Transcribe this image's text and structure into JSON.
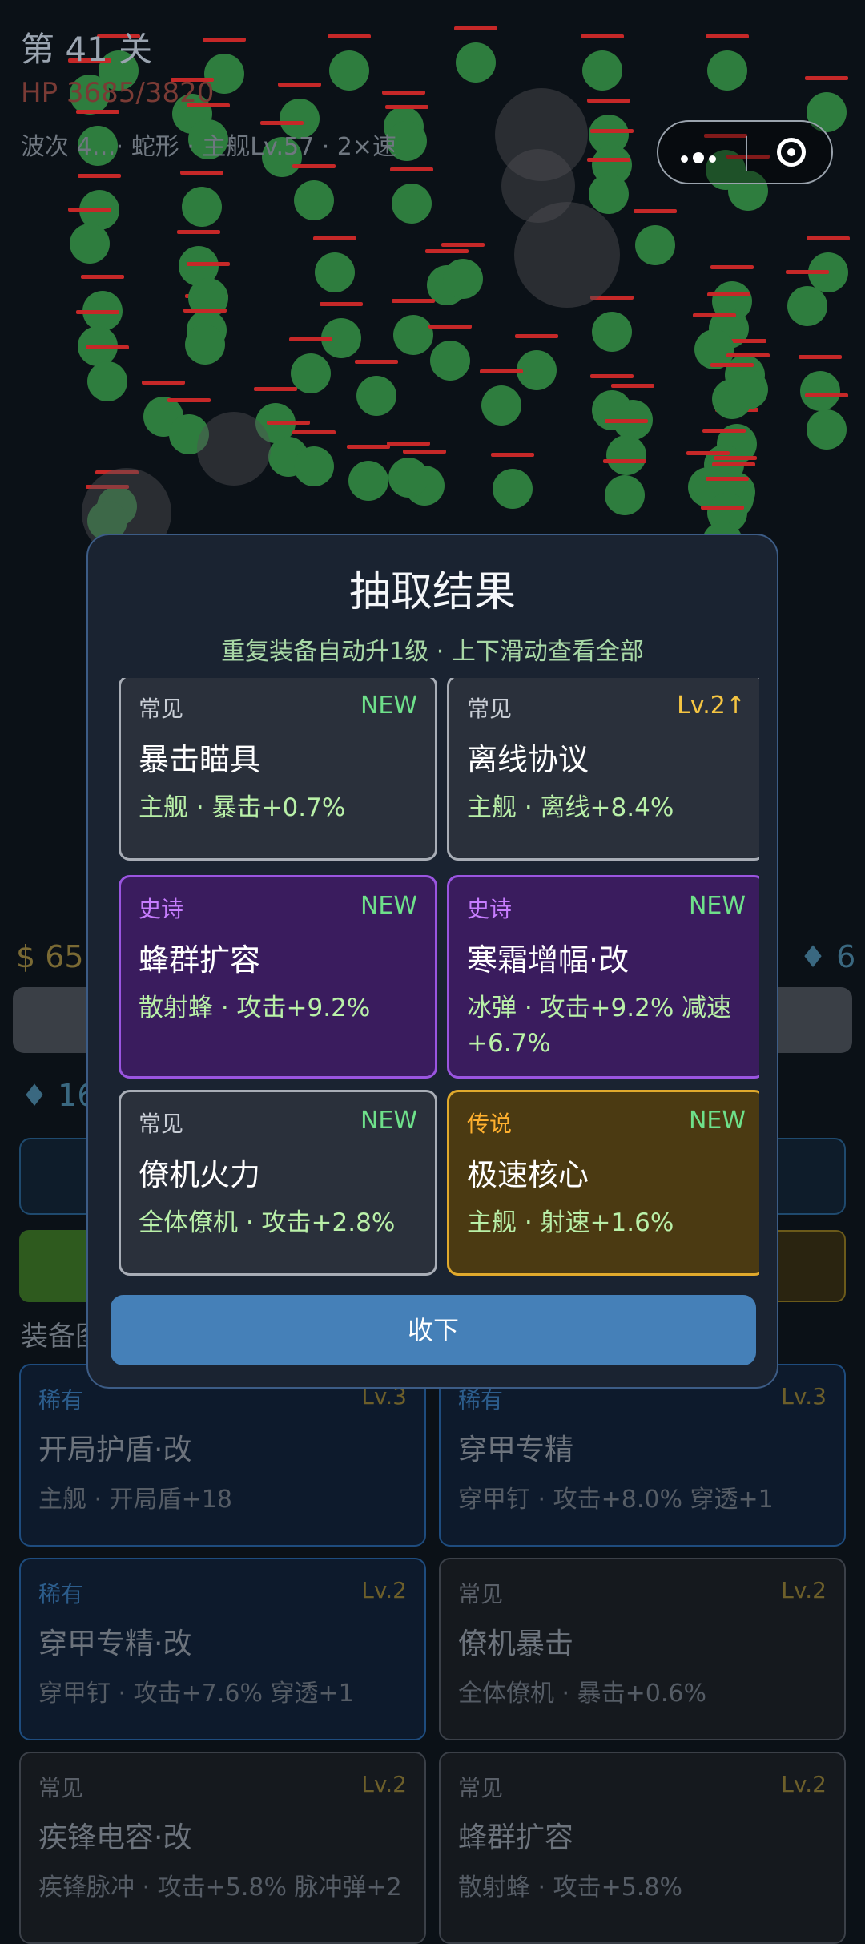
{
  "hud": {
    "level": "第 41 关",
    "hp": "HP 3685/3820",
    "wave": "波次 4…· 蛇形 · 主舰Lv.57 · 2×速"
  },
  "shop": {
    "money": "$ 65.",
    "gems_right": "♦ 6",
    "gems_left": "♦ 16"
  },
  "inventory": {
    "title": "装备图",
    "items": [
      {
        "rarity": "稀有",
        "level": "Lv.3",
        "name": "开局护盾·改",
        "desc": "主舰 · 开局盾+18"
      },
      {
        "rarity": "稀有",
        "level": "Lv.3",
        "name": "穿甲专精",
        "desc": "穿甲钉 · 攻击+8.0% 穿透+1"
      },
      {
        "rarity": "稀有",
        "level": "Lv.2",
        "name": "穿甲专精·改",
        "desc": "穿甲钉 · 攻击+7.6% 穿透+1"
      },
      {
        "rarity": "常见",
        "level": "Lv.2",
        "name": "僚机暴击",
        "desc": "全体僚机 · 暴击+0.6%"
      },
      {
        "rarity": "常见",
        "level": "Lv.2",
        "name": "疾锋电容·改",
        "desc": "疾锋脉冲 · 攻击+5.8% 脉冲弹+2"
      },
      {
        "rarity": "常见",
        "level": "Lv.2",
        "name": "蜂群扩容",
        "desc": "散射蜂 · 攻击+5.8%"
      }
    ]
  },
  "modal": {
    "title": "抽取结果",
    "subtitle": "重复装备自动升1级 · 上下滑动查看全部",
    "results": [
      {
        "rarity": "常见",
        "tag": "NEW",
        "name": "暴击瞄具",
        "desc": "主舰 · 暴击+0.7%"
      },
      {
        "rarity": "常见",
        "tag": "Lv.2↑",
        "name": "离线协议",
        "desc": "主舰 · 离线+8.4%"
      },
      {
        "rarity": "史诗",
        "tag": "NEW",
        "name": "蜂群扩容",
        "desc": "散射蜂 · 攻击+9.2%"
      },
      {
        "rarity": "史诗",
        "tag": "NEW",
        "name": "寒霜增幅·改",
        "desc": "冰弹 · 攻击+9.2% 减速+6.7%"
      },
      {
        "rarity": "常见",
        "tag": "NEW",
        "name": "僚机火力",
        "desc": "全体僚机 · 攻击+2.8%"
      },
      {
        "rarity": "传说",
        "tag": "NEW",
        "name": "极速核心",
        "desc": "主舰 · 射速+1.6%"
      }
    ],
    "collect_label": "收下"
  },
  "colors": {
    "enemy": "#2e7d3e",
    "enemy_hp": "#c62828",
    "modal_border": "#3c5c86",
    "epic": "#9a55e0",
    "legend": "#e0a92c",
    "new_tag": "#6ee08a",
    "button": "#4580b8"
  }
}
